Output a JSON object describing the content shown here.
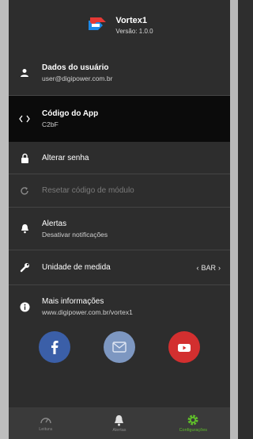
{
  "app": {
    "title": "Vortex1",
    "version": "Versão: 1.0.0",
    "brand_red": "#e53935",
    "brand_blue": "#1e88e5"
  },
  "menu": {
    "user_data": {
      "title": "Dados do usuário",
      "subtitle": "user@digipower.com.br",
      "icon": "person-icon"
    },
    "app_code": {
      "title": "Código do App",
      "subtitle": "C2bF",
      "icon": "code-icon",
      "selected": true
    },
    "change_password": {
      "title": "Alterar senha",
      "icon": "lock-icon"
    },
    "reset_module": {
      "title": "Resetar código de módulo",
      "icon": "refresh-icon",
      "disabled": true
    },
    "alerts": {
      "title": "Alertas",
      "subtitle": "Desativar notificações",
      "icon": "bell-icon"
    },
    "unit": {
      "title": "Unidade de medida",
      "value": "BAR",
      "icon": "wrench-icon"
    },
    "info": {
      "title": "Mais informações",
      "subtitle": "www.digipower.com.br/vortex1",
      "icon": "info-icon"
    }
  },
  "social": [
    {
      "name": "facebook",
      "color": "#3b5fa8"
    },
    {
      "name": "email",
      "color": "#7d97c1"
    },
    {
      "name": "youtube",
      "color": "#d32f2f"
    }
  ],
  "bottom_nav": [
    {
      "label": "Leitura",
      "icon": "gauge-icon",
      "active": false
    },
    {
      "label": "Alertas",
      "icon": "bell-icon",
      "active": false
    },
    {
      "label": "Configurações",
      "icon": "gear-icon",
      "active": true
    }
  ],
  "colors": {
    "active": "#5fbf2a",
    "background": "#2d2d2d",
    "selected_row": "#0b0b0b"
  }
}
